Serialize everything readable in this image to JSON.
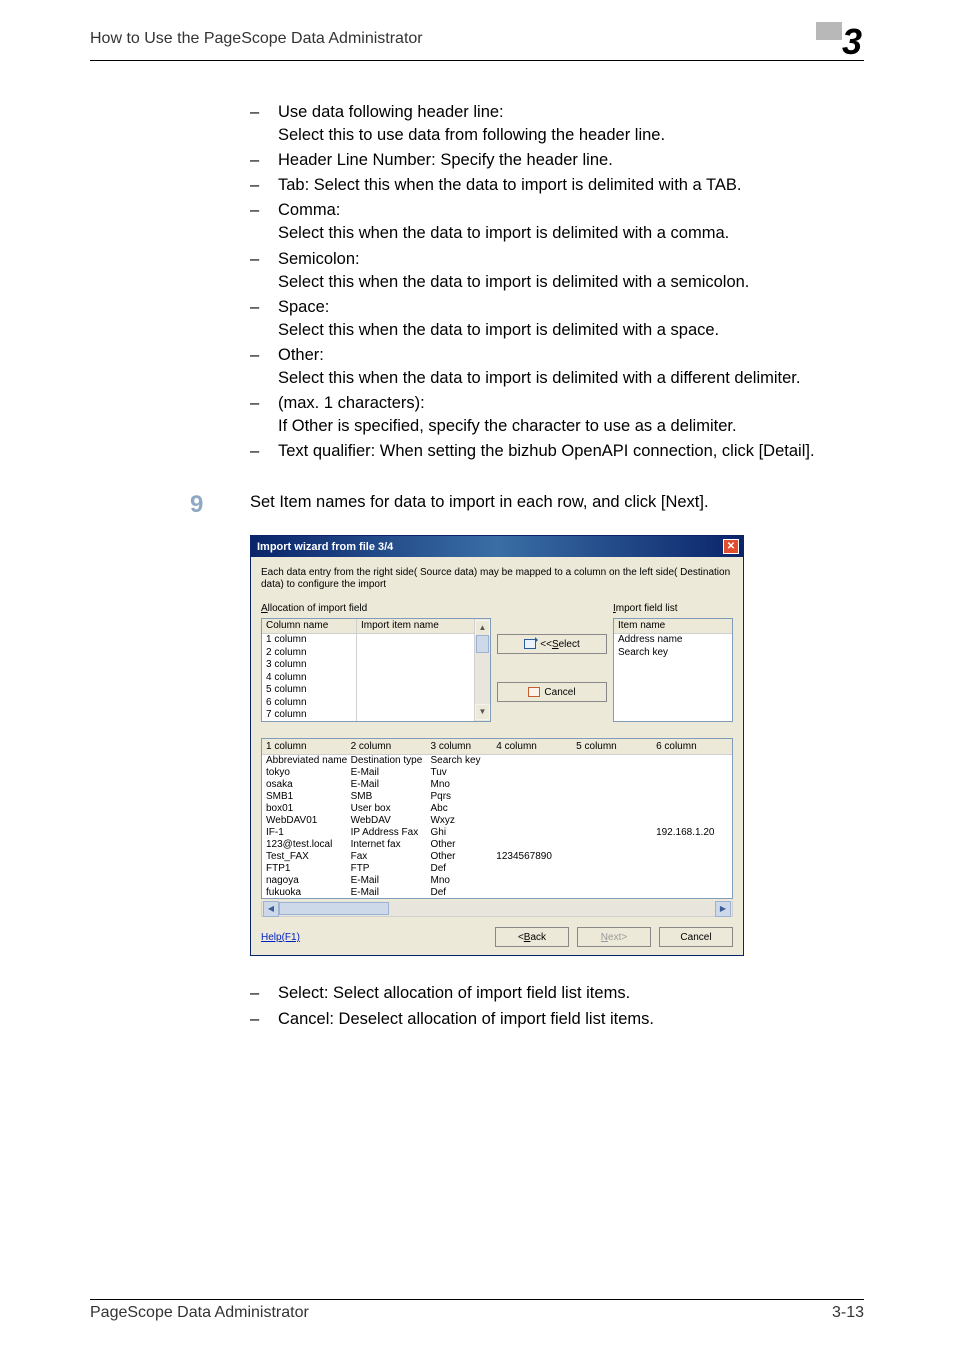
{
  "header": {
    "title": "How to Use the PageScope Data Administrator",
    "chapter": "3"
  },
  "bullets_top": [
    {
      "label": "Use data following header line:",
      "desc": "Select this to use data from following the header line."
    },
    {
      "label": "Header Line Number: Specify the header line.",
      "desc": ""
    },
    {
      "label": "Tab: Select this when the data to import is delimited with a TAB.",
      "desc": ""
    },
    {
      "label": "Comma:",
      "desc": "Select this when the data to import is delimited with a comma."
    },
    {
      "label": "Semicolon:",
      "desc": "Select this when the data to import is delimited with a semicolon."
    },
    {
      "label": "Space:",
      "desc": "Select this when the data to import is delimited with a space."
    },
    {
      "label": "Other:",
      "desc": "Select this when the data to import is delimited with a different delimiter."
    },
    {
      "label": "(max. 1 characters):",
      "desc": "If Other is specified, specify the character to use as a delimiter."
    },
    {
      "label": "Text qualifier: When setting the bizhub OpenAPI connection, click [Detail].",
      "desc": ""
    }
  ],
  "step": {
    "number": "9",
    "text": "Set Item names for data to import in each row, and click [Next]."
  },
  "dialog": {
    "title": "Import wizard from file 3/4",
    "desc": "Each data entry from the right side( Source data) may be mapped to a column on the left side( Destination data) to configure the import",
    "alloc_label": "Allocation of import field",
    "alloc_underline": "A",
    "import_label": "Import field list",
    "import_underline": "I",
    "col_header_left": "Column name",
    "col_header_right": "Import item name",
    "alloc_rows": [
      "1 column",
      "2 column",
      "3 column",
      "4 column",
      "5 column",
      "6 column",
      "7 column"
    ],
    "field_header": "Item name",
    "field_rows": [
      "Address name",
      "Search key"
    ],
    "btn_select": "<<Select",
    "btn_select_underline": "S",
    "btn_cancel": "Cancel",
    "table": {
      "headers": [
        "1 column",
        "2 column",
        "3 column",
        "4 column",
        "5 column",
        "6 column"
      ],
      "rows": [
        [
          "Abbreviated name",
          "Destination type",
          "Search key",
          "",
          "",
          ""
        ],
        [
          "tokyo",
          "E-Mail",
          "Tuv",
          "",
          "",
          ""
        ],
        [
          "osaka",
          "E-Mail",
          "Mno",
          "",
          "",
          ""
        ],
        [
          "SMB1",
          "SMB",
          "Pqrs",
          "",
          "",
          ""
        ],
        [
          "box01",
          "User box",
          "Abc",
          "",
          "",
          ""
        ],
        [
          "WebDAV01",
          "WebDAV",
          "Wxyz",
          "",
          "",
          ""
        ],
        [
          "IF-1",
          "IP Address Fax",
          "Ghi",
          "",
          "",
          "192.168.1.20"
        ],
        [
          "123@test.local",
          "Internet fax",
          "Other",
          "",
          "",
          ""
        ],
        [
          "Test_FAX",
          "Fax",
          "Other",
          "1234567890",
          "",
          ""
        ],
        [
          "FTP1",
          "FTP",
          "Def",
          "",
          "",
          ""
        ],
        [
          "nagoya",
          "E-Mail",
          "Mno",
          "",
          "",
          ""
        ],
        [
          "fukuoka",
          "E-Mail",
          "Def",
          "",
          "",
          ""
        ]
      ]
    },
    "help": "Help(F1)",
    "back": "<Back",
    "back_underline": "B",
    "next": "Next>",
    "next_underline": "N",
    "cancel": "Cancel"
  },
  "bullets_bottom": [
    {
      "text": "Select: Select allocation of import field list items."
    },
    {
      "text": "Cancel: Deselect allocation of import field list items."
    }
  ],
  "footer": {
    "product": "PageScope Data Administrator",
    "page": "3-13"
  }
}
